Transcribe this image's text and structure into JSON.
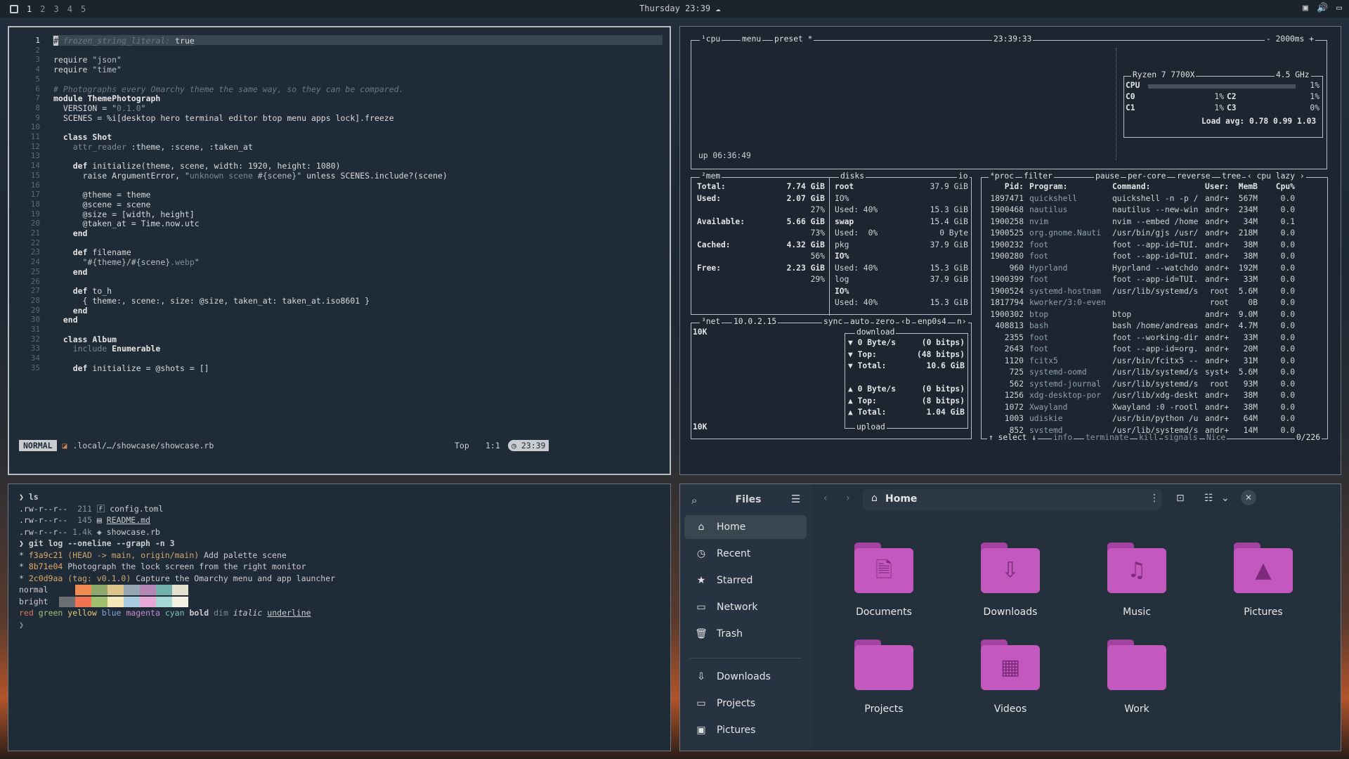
{
  "topbar": {
    "workspaces": [
      "1",
      "2",
      "3",
      "4",
      "5"
    ],
    "active_workspace": "1",
    "clock": "Thursday 23:39",
    "clock_icon": "cloud-icon",
    "tray_icons": [
      "screen-icon",
      "volume-icon",
      "display-icon"
    ]
  },
  "editor": {
    "lines": [
      {
        "n": "1",
        "html": "<span style='background:#c9ccd1;color:#1f2b37'>#</span><span class='c' style='background:#3a4652'> frozen_string_literal: </span><span style='background:#3a4652'>true</span>"
      },
      {
        "n": "2",
        "html": ""
      },
      {
        "n": "3",
        "html": "require <span class='s'>\"json\"</span>"
      },
      {
        "n": "4",
        "html": "require <span class='s'>\"time\"</span>"
      },
      {
        "n": "5",
        "html": ""
      },
      {
        "n": "6",
        "html": "<span class='c'># Photographs every Omarchy theme the same way, so they can be compared.</span>"
      },
      {
        "n": "7",
        "html": "<span class='k'>module</span> <span class='k'>ThemePhotograph</span>"
      },
      {
        "n": "8",
        "html": "  VERSION = <span class='s'>\"<span class='sd'>0.1.0</span>\"</span>"
      },
      {
        "n": "9",
        "html": "  SCENES = %i[desktop hero terminal editor btop menu apps lock].freeze"
      },
      {
        "n": "10",
        "html": ""
      },
      {
        "n": "11",
        "html": "  <span class='k'>class</span> <span class='k'>Shot</span>"
      },
      {
        "n": "12",
        "html": "    <span class='sd'>attr_reader</span> :theme, :scene, :taken_at"
      },
      {
        "n": "13",
        "html": ""
      },
      {
        "n": "14",
        "html": "    <span class='k'>def</span> initialize(theme, scene, width: 1920, height: 1080)"
      },
      {
        "n": "15",
        "html": "      raise ArgumentError, <span class='s'>\"<span class='sd'>unknown scene</span> #{scene}\"</span> unless SCENES.include?(scene)"
      },
      {
        "n": "16",
        "html": ""
      },
      {
        "n": "17",
        "html": "      @theme = theme"
      },
      {
        "n": "18",
        "html": "      @scene = scene"
      },
      {
        "n": "19",
        "html": "      @size = [width, height]"
      },
      {
        "n": "20",
        "html": "      @taken_at = Time.now.utc"
      },
      {
        "n": "21",
        "html": "    <span class='k'>end</span>"
      },
      {
        "n": "22",
        "html": ""
      },
      {
        "n": "23",
        "html": "    <span class='k'>def</span> filename"
      },
      {
        "n": "24",
        "html": "      <span class='s'>\"#{theme}/#{scene}<span class='sd'>.webp</span>\"</span>"
      },
      {
        "n": "25",
        "html": "    <span class='k'>end</span>"
      },
      {
        "n": "26",
        "html": ""
      },
      {
        "n": "27",
        "html": "    <span class='k'>def</span> to_h"
      },
      {
        "n": "28",
        "html": "      { theme:, scene:, size: @size, taken_at: taken_at.iso8601 }"
      },
      {
        "n": "29",
        "html": "    <span class='k'>end</span>"
      },
      {
        "n": "30",
        "html": "  <span class='k'>end</span>"
      },
      {
        "n": "31",
        "html": ""
      },
      {
        "n": "32",
        "html": "  <span class='k'>class</span> <span class='k'>Album</span>"
      },
      {
        "n": "33",
        "html": "    <span class='sd'>include</span> <span class='k'>Enumerable</span>"
      },
      {
        "n": "34",
        "html": ""
      },
      {
        "n": "35",
        "html": "    <span class='k'>def</span> initialize = @shots = []"
      }
    ],
    "status": {
      "mode": "NORMAL",
      "file": ".local/…/showcase/showcase.rb",
      "position": "Top",
      "cursor": "1:1",
      "time": "23:39"
    }
  },
  "btop": {
    "cpu_box": {
      "labels": [
        "¹cpu",
        "menu",
        "preset *"
      ],
      "time": "23:39:33",
      "refresh": "- 2000ms +",
      "uptime": "up 06:36:49",
      "model": "Ryzen 7 7700X",
      "freq": "4.5 GHz",
      "rows": [
        {
          "name": "CPU",
          "pct": "1%"
        },
        {
          "name": "C0",
          "pct": "1%",
          "name2": "C2",
          "pct2": "1%"
        },
        {
          "name": "C1",
          "pct": "1%",
          "name2": "C3",
          "pct2": "0%"
        }
      ],
      "load": "Load avg: 0.78 0.99 1.03"
    },
    "mem": {
      "label": "²mem",
      "rows": [
        [
          "Total:",
          "7.74 GiB"
        ],
        [
          "Used:",
          "2.07 GiB"
        ],
        [
          "",
          "27%"
        ],
        [
          "Available:",
          "5.66 GiB"
        ],
        [
          "",
          "73%"
        ],
        [
          "Cached:",
          "4.32 GiB"
        ],
        [
          "",
          "56%"
        ],
        [
          "Free:",
          "2.23 GiB"
        ],
        [
          "",
          "29%"
        ]
      ]
    },
    "disks": {
      "label": "disks",
      "io": "io",
      "rows": [
        [
          "root",
          "37.9 GiB"
        ],
        [
          "IO%",
          ""
        ],
        [
          "Used: 40%",
          "15.3 GiB"
        ],
        [
          "swap",
          "15.4 GiB"
        ],
        [
          "Used:  0%",
          "0 Byte"
        ],
        [
          "pkg",
          "37.9 GiB"
        ],
        [
          "IO%",
          ""
        ],
        [
          "Used: 40%",
          "15.3 GiB"
        ],
        [
          "log",
          "37.9 GiB"
        ],
        [
          "IO%",
          ""
        ],
        [
          "Used: 40%",
          "15.3 GiB"
        ]
      ]
    },
    "net": {
      "label": "³net",
      "ip": "10.0.2.15",
      "opts": [
        "sync",
        "auto",
        "zero",
        "‹b",
        "enp0s4",
        "n›"
      ],
      "scale_top": "10K",
      "scale_bottom": "10K",
      "download": "download",
      "upload": "upload",
      "rows": [
        [
          "▼ 0 Byte/s",
          "(0 bitps)"
        ],
        [
          "▼ Top:",
          "(48 bitps)"
        ],
        [
          "▼ Total:",
          "10.6 GiB"
        ],
        [
          "",
          ""
        ],
        [
          "▲ 0 Byte/s",
          "(0 bitps)"
        ],
        [
          "▲ Top:",
          "(8 bitps)"
        ],
        [
          "▲ Total:",
          "1.04 GiB"
        ]
      ]
    },
    "proc": {
      "labels": [
        "⁴proc",
        "filter",
        "pause",
        "per-core",
        "reverse",
        "tree",
        "‹ cpu lazy ›"
      ],
      "headers": [
        "Pid:",
        "Program:",
        "Command:",
        "User:",
        "MemB",
        "Cpu%"
      ],
      "rows": [
        [
          "1897471",
          "quickshell",
          "quickshell -n -p /",
          "andr+",
          "567M",
          "0.0"
        ],
        [
          "1900468",
          "nautilus",
          "nautilus --new-win",
          "andr+",
          "234M",
          "0.0"
        ],
        [
          "1900258",
          "nvim",
          "nvim --embed /home",
          "andr+",
          "34M",
          "0.1"
        ],
        [
          "1900525",
          "org.gnome.Nauti",
          "/usr/bin/gjs /usr/",
          "andr+",
          "218M",
          "0.0"
        ],
        [
          "1900232",
          "foot",
          "foot --app-id=TUI.",
          "andr+",
          "38M",
          "0.0"
        ],
        [
          "1900280",
          "foot",
          "foot --app-id=TUI.",
          "andr+",
          "38M",
          "0.0"
        ],
        [
          "960",
          "Hyprland",
          "Hyprland --watchdo",
          "andr+",
          "192M",
          "0.0"
        ],
        [
          "1900399",
          "foot",
          "foot --app-id=TUI.",
          "andr+",
          "33M",
          "0.0"
        ],
        [
          "1900524",
          "systemd-hostnam",
          "/usr/lib/systemd/s",
          "root",
          "5.6M",
          "0.0"
        ],
        [
          "1817794",
          "kworker/3:0-even",
          "",
          "root",
          "0B",
          "0.0"
        ],
        [
          "1900302",
          "btop",
          "btop",
          "andr+",
          "9.0M",
          "0.0"
        ],
        [
          "408813",
          "bash",
          "bash /home/andreas",
          "andr+",
          "4.7M",
          "0.0"
        ],
        [
          "2355",
          "foot",
          "foot --working-dir",
          "andr+",
          "33M",
          "0.0"
        ],
        [
          "2643",
          "foot",
          "foot --app-id=org.",
          "andr+",
          "20M",
          "0.0"
        ],
        [
          "1120",
          "fcitx5",
          "/usr/bin/fcitx5 --",
          "andr+",
          "31M",
          "0.0"
        ],
        [
          "725",
          "systemd-oomd",
          "/usr/lib/systemd/s",
          "syst+",
          "5.6M",
          "0.0"
        ],
        [
          "562",
          "systemd-journal",
          "/usr/lib/systemd/s",
          "root",
          "93M",
          "0.0"
        ],
        [
          "1256",
          "xdg-desktop-por",
          "/usr/lib/xdg-deskt",
          "andr+",
          "38M",
          "0.0"
        ],
        [
          "1072",
          "Xwayland",
          "Xwayland :0 -rootl",
          "andr+",
          "38M",
          "0.0"
        ],
        [
          "1003",
          "udiskie",
          "/usr/bin/python /u",
          "andr+",
          "64M",
          "0.0"
        ],
        [
          "852",
          "systemd",
          "/usr/lib/systemd/s",
          "andr+",
          "14M",
          "0.0"
        ]
      ],
      "footer": [
        "↑ select ↓",
        "info",
        "terminate",
        "kill",
        "signals",
        "Nice"
      ],
      "count": "0/226"
    }
  },
  "terminal": {
    "lines": [
      "<span class='k'>❯</span> <b>ls</b>",
      ".rw-r--r--  <span style='color:#8a939c'>211</span> <span>🄵</span> config.toml",
      ".rw-r--r--  <span style='color:#8a939c'>145</span> <span>▤</span> <u>README.md</u>",
      ".rw-r--r-- <span style='color:#8a939c'>1.4k</span> <span>◈</span> showcase.rb",
      "<span class='k'>❯</span> <b>git log --oneline --graph -n 3</b>",
      "* <span style='color:#e1a96b'>f3a9c21</span> <span style='color:#cfa86f'>(HEAD -&gt; main, origin/main)</span> Add palette scene",
      "* <span style='color:#e1a96b'>8b71e04</span> Photograph the lock screen from the right monitor",
      "* <span style='color:#e1a96b'>2c0d9aa</span> <span style='color:#cfa86f'>(tag: v0.1.0)</span> Capture the Omarchy menu and app launcher",
      "normal PALETTE_NORMAL",
      "bright PALETTE_BRIGHT",
      "<span style='color:#e07060'>red</span> <span style='color:#9ec27a'>green</span> <span style='color:#e8c97a'>yellow</span> <span style='color:#7fa7d8'>blue</span> <span style='color:#c78bd0'>magenta</span> <span style='color:#80c4c2'>cyan</span> <b>bold</b> <span style='color:#7f8891'>dim</span> <i>italic</i> <u>underline</u>",
      "<span style='color:#8a939c'>❯</span>"
    ],
    "palette_normal": [
      "#f08a4f",
      "#8fa86a",
      "#dcc48a",
      "#97a6b3",
      "#b585b5",
      "#72b0ad",
      "#e4e1cf"
    ],
    "palette_bright": [
      "#6b6f74",
      "#f2734f",
      "#9fc06e",
      "#f5e7b7",
      "#a9cbe0",
      "#e8a8d6",
      "#a5d9d6",
      "#f4f0e4"
    ]
  },
  "files": {
    "title": "Files",
    "location": "Home",
    "sidebar": [
      {
        "label": "Home",
        "icon": "home-icon",
        "glyph": "⌂",
        "selected": true
      },
      {
        "label": "Recent",
        "icon": "clock-icon",
        "glyph": "◷"
      },
      {
        "label": "Starred",
        "icon": "star-icon",
        "glyph": "★"
      },
      {
        "label": "Network",
        "icon": "network-icon",
        "glyph": "▭"
      },
      {
        "label": "Trash",
        "icon": "trash-icon",
        "glyph": "🗑"
      },
      {
        "label": "Downloads",
        "icon": "download-icon",
        "glyph": "⇩"
      },
      {
        "label": "Projects",
        "icon": "folder-icon",
        "glyph": "▭"
      },
      {
        "label": "Pictures",
        "icon": "image-icon",
        "glyph": "▣"
      }
    ],
    "folders": [
      {
        "label": "Documents",
        "glyph": "🗎",
        "icon": "document-folder-icon"
      },
      {
        "label": "Downloads",
        "glyph": "⇩",
        "icon": "download-folder-icon"
      },
      {
        "label": "Music",
        "glyph": "♫",
        "icon": "music-folder-icon"
      },
      {
        "label": "Pictures",
        "glyph": "▲",
        "icon": "pictures-folder-icon"
      },
      {
        "label": "Projects",
        "glyph": "",
        "icon": "projects-folder-icon"
      },
      {
        "label": "Videos",
        "glyph": "▦",
        "icon": "videos-folder-icon"
      },
      {
        "label": "Work",
        "glyph": "",
        "icon": "work-folder-icon"
      }
    ]
  }
}
